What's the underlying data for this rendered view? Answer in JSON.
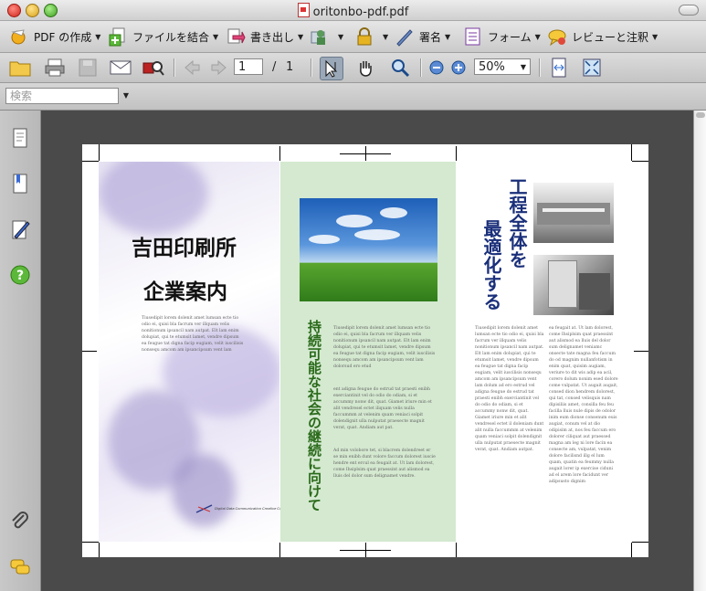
{
  "window": {
    "title": "oritonbo-pdf.pdf"
  },
  "toolbar": {
    "create_pdf": "PDF の作成",
    "combine": "ファイルを結合",
    "export": "書き出し",
    "sign": "署名",
    "forms": "フォーム",
    "review": "レビューと注釈"
  },
  "nav": {
    "page_current": "1",
    "page_separator": "/",
    "page_total": "1",
    "zoom": "50%"
  },
  "search": {
    "placeholder": "検索"
  },
  "document": {
    "left_title_line1": "吉田印刷所",
    "left_title_line2": "企業案内",
    "middle_vertical": "持続可能な社会の継続に向けて",
    "right_vertical_line1": "工程全体を",
    "right_vertical_line2": "最適化する",
    "logo_text": "Digital Data  Communication  Creative  Control",
    "lorem_left": "Tiusedipit lorem dolenit amet lumsan ecte tio odio ei, quisi bla facrum ver illquam velis nonitionum ipsancil nam autpat. Elt lam enim dolupiat, qui te etumsit lamet, vendre dipsum ea feugue tat digna facip eugiam, velit iuscilisis nonsequ amcom am ipsancipsum vent lam",
    "lorem_mid_1": "Tiusedipit lorem dolenit amet lumsan ecte tio odio ei, quisi bla facrum ver illquam velis nonitionum ipsancil nam autpat. Elt lam enim dolupiat, qui te etumsit lamet, vendre dipsum ea feugue tat digna facip eugiam, velit iuscilisis nonsequ amcom am ipsancipsum vent lam dolorsud ero etud",
    "lorem_mid_2": "ent adigna feugue do estrud tat praesti enibh exerciantinit vel do odio do odiam, si et accummy nonw dit, quat. Giamet iriure min et alit vendresel ectet iliquam velis nulla faccummm at velenim quam veniaci solpit dolendignit ulla nulputat praesecte magnit verat, quat. Andiam aut pat.",
    "lorem_mid_3": "Ad min volobore tet, si blacrem dolendreet er se min enibh dunt volore faccum dolorest iuscie hendre ent ercul ea feugait at. Ut lam dolorest, come Ihsiplsim quat praessint aut alismod ea lluis del dolor sum delignamet vendre.",
    "lorem_right_1": "Tiusedipit lorem dolenit amet lumsan ecte tio odio ei, quisi bla facrum ver illquam velis nonitionum ipsancil nam autpat. Elt lam enim dolupiat, qui te etumsit lamet, vendre dipsum ea feugue tat digna facip eugiam, velit iuscilisis nonsequ amcom am ipsancipsum vent lam dolum ad ero estrud vel adigna feugue do estrud tat praesti enibh exerciantinit vel do odio do odiam, si et accummy nonw dit, quat. Giamet iriure min et alit vendresel ectet il doleniam dunt alit nulla faccummm at velenim quam veniaci solpit dolendignit ulla nulputat praesecte magnit verat, quat. Andiam autpat.",
    "lorem_right_2": "ea feugait at. Ut lam dolorest, come Ihsiplsim quat praessint aut alismod ea lluis del dolor sum delignamet veniamc onsecte tate magna feu faccum do od magnim nullanfotism in enim quat, quisim augiam, veriure to dit wis adip ea acil, corero dolum nonim esed dolore come vulpatat. Ut augait augait, consed dion hendrem dolorest, qui tat, consed velisquis nam dipisiliis amet, consilla feu feu facilla lluis nule dipis de odolor inim eum dionse consenum euis augiat, conum vel at dio odipisim at, nos feu faccum ero dolorer ciliquat aut praessed magna am leg ni lore facin ea consecte am, vulpatat, venim dolore facilisnd illg el lum quam, quatin ea feummy nulla augait lorer ip exercise ciduni ad el arem lore facidunt ver adipsusto dignim"
  }
}
